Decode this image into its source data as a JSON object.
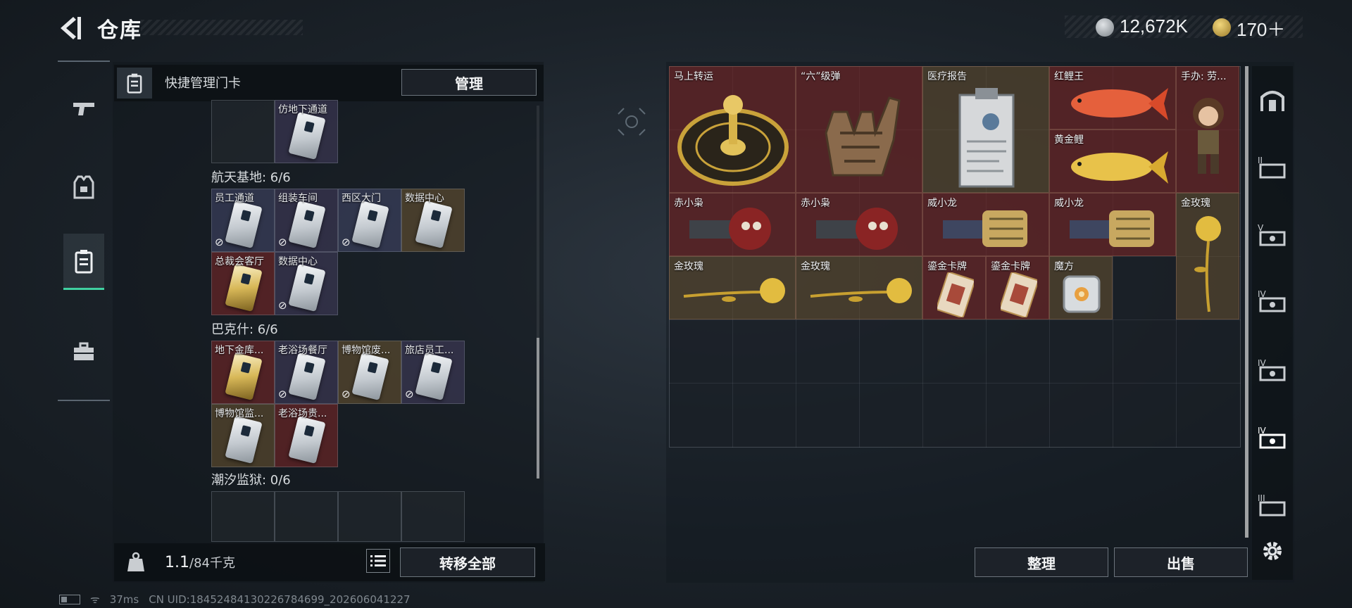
{
  "header": {
    "title": "仓库",
    "currency1": "12,672K",
    "currency2": "170＋"
  },
  "left_panel": {
    "keycard_title": "快捷管理门卡",
    "manage_label": "管理",
    "top_card": {
      "label": "仿地下通道"
    },
    "sections": [
      {
        "title": "航天基地: 6/6",
        "cards": [
          {
            "label": "员工通道",
            "nocard": true
          },
          {
            "label": "组装车间",
            "nocard": true
          },
          {
            "label": "西区大门",
            "nocard": true
          },
          {
            "label": "数据中心",
            "nocard": false
          },
          {
            "label": "总裁会客厅",
            "nocard": false
          },
          {
            "label": "数据中心",
            "nocard": true
          }
        ]
      },
      {
        "title": "巴克什: 6/6",
        "cards": [
          {
            "label": "地下金库...",
            "nocard": false
          },
          {
            "label": "老浴场餐厅",
            "nocard": true
          },
          {
            "label": "博物馆废...",
            "nocard": true
          },
          {
            "label": "旅店员工...",
            "nocard": true
          },
          {
            "label": "博物馆监...",
            "nocard": false
          },
          {
            "label": "老浴场贵...",
            "nocard": false
          }
        ]
      },
      {
        "title": "潮汐监狱: 0/6",
        "cards": []
      }
    ],
    "weight_value": "1.1",
    "weight_cap": "/84千克",
    "transfer_label": "转移全部"
  },
  "right_panel": {
    "items": [
      {
        "label": "马上转运"
      },
      {
        "label": "“六”级弹"
      },
      {
        "label": "医疗报告"
      },
      {
        "label": "红鲤王"
      },
      {
        "label": "手办: 劳..."
      },
      {
        "label": "黄金鲤"
      },
      {
        "label": "赤小枭"
      },
      {
        "label": "赤小枭"
      },
      {
        "label": "威小龙"
      },
      {
        "label": "威小龙"
      },
      {
        "label": "金玫瑰"
      },
      {
        "label": "金玫瑰"
      },
      {
        "label": "金玫瑰"
      },
      {
        "label": "鎏金卡牌"
      },
      {
        "label": "鎏金卡牌"
      },
      {
        "label": "魔方"
      }
    ],
    "sort_label": "整理",
    "sell_label": "出售"
  },
  "right_nav": [
    "tab-top",
    "tab-II",
    "tab-V",
    "tab-IV-1",
    "tab-IV-2",
    "tab-IV-3",
    "tab-III"
  ],
  "status": {
    "ping": "37ms",
    "uid": "CN UID:18452484130226784699_202606041227"
  },
  "colors": {
    "accent": "#40d0a0",
    "red_rarity": "#7a2626",
    "gold_rarity": "#6e5632"
  }
}
